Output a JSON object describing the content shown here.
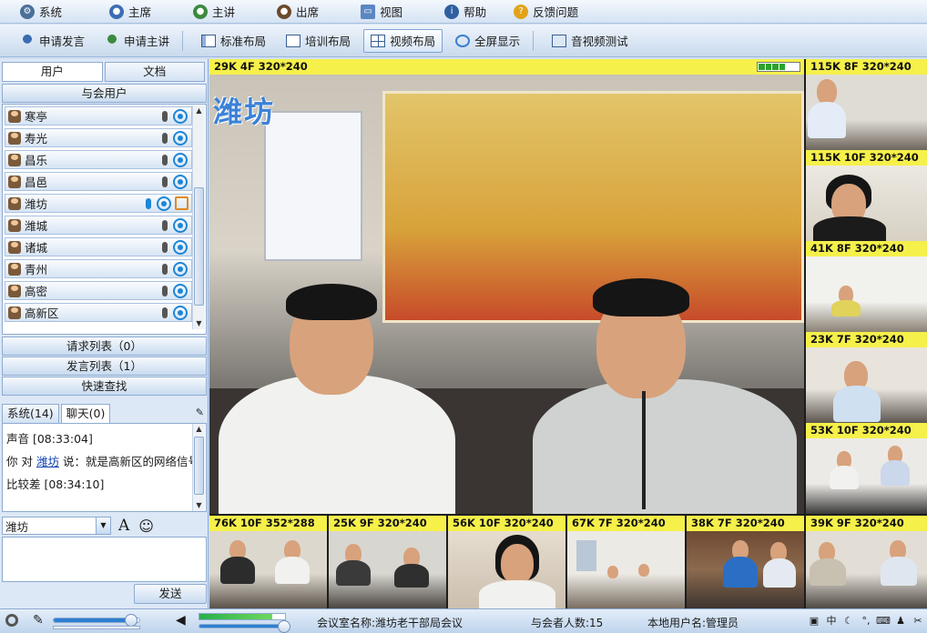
{
  "menu": [
    {
      "label": "系统",
      "icon": "gear-icon"
    },
    {
      "label": "主席",
      "icon": "user-icon"
    },
    {
      "label": "主讲",
      "icon": "user-icon"
    },
    {
      "label": "出席",
      "icon": "user-icon"
    },
    {
      "label": "视图",
      "icon": "monitor-icon"
    },
    {
      "label": "帮助",
      "icon": "info-icon"
    },
    {
      "label": "反馈问题",
      "icon": "question-icon"
    }
  ],
  "toolbar": {
    "request_speak": "申请发言",
    "request_present": "申请主讲",
    "layout_standard": "标准布局",
    "layout_training": "培训布局",
    "layout_video": "视频布局",
    "fullscreen": "全屏显示",
    "av_test": "音视频测试"
  },
  "left": {
    "tab_users": "用户",
    "tab_docs": "文档",
    "attendees_header": "与会用户",
    "users": [
      "寒亭",
      "寿光",
      "昌乐",
      "昌邑",
      "潍坊",
      "潍城",
      "诸城",
      "青州",
      "高密",
      "高新区"
    ],
    "request_list": "请求列表（0）",
    "speak_list": "发言列表（1）",
    "quick_search": "快速查找",
    "chat_tab_system": "系统(14)",
    "chat_tab_chat": "聊天(0)",
    "chat_line1": "声音 [08:33:04]",
    "chat_line2_pre": "你 对 ",
    "chat_line2_link": "潍坊",
    "chat_line2_post": " 说：就是高新区的网络信号",
    "chat_line3": "比较差 [08:34:10]",
    "chat_target": "潍坊",
    "send": "发送"
  },
  "video": {
    "main_label": "29K 4F 320*240",
    "main_overlay": "潍坊",
    "signal_level": 0.6,
    "side_labels": [
      "115K 8F 320*240",
      "115K 10F 320*240",
      "41K 8F 320*240",
      "23K 7F 320*240",
      "53K 10F 320*240"
    ],
    "bottom_labels": [
      "76K 10F 352*288",
      "25K 9F 320*240",
      "56K 10F 320*240",
      "67K 7F 320*240",
      "38K 7F 320*240",
      "39K 9F 320*240"
    ]
  },
  "status": {
    "room": "会议室名称:潍坊老干部局会议",
    "attendee_count": "与会者人数:15",
    "local_user": "本地用户名:管理员",
    "mic_volume": 0.9,
    "speaker_level": 0.85,
    "tray_text": "中"
  },
  "colors": {
    "label_yellow": "#f5f04a",
    "accent_blue": "#1d86d6",
    "panel_blue": "#dce8f6"
  }
}
